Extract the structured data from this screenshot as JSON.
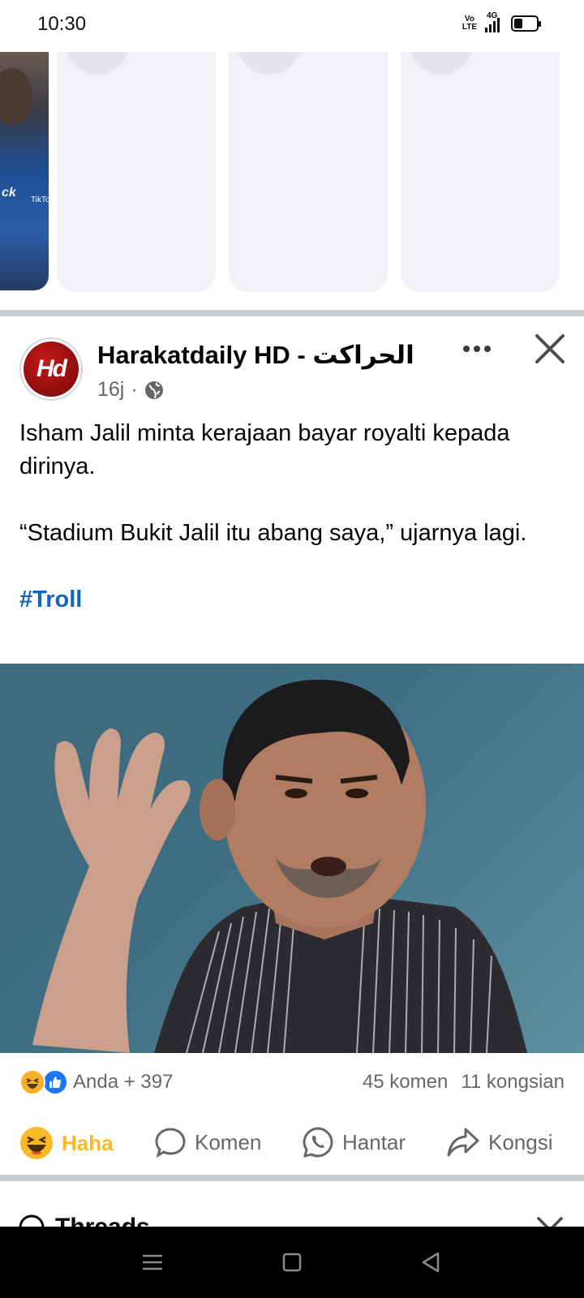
{
  "status_bar": {
    "time": "10:30",
    "volte_top": "Vo",
    "volte_bottom": "LTE",
    "network": "4G",
    "battery_level": 0.4
  },
  "stories": {
    "first_story_text": "ck",
    "first_story_brand": "TikTok"
  },
  "post": {
    "page_name": "Harakatdaily HD - الحراكت",
    "avatar_text": "Hd",
    "time_ago": "16j",
    "meta_separator": "·",
    "privacy_icon": "globe-icon",
    "text_line1": "Isham Jalil minta kerajaan bayar royalti kepada dirinya.",
    "text_line2": "“Stadium Bukit Jalil itu abang saya,” ujarnya lagi.",
    "hashtag": "#Troll",
    "reactions_label": "Anda + 397",
    "comments_label": "45 komen",
    "shares_label": "11 kongsian"
  },
  "actions": {
    "haha_label": "Haha",
    "comment_label": "Komen",
    "send_label": "Hantar",
    "share_label": "Kongsi"
  },
  "next_post": {
    "title": "Threads"
  },
  "colors": {
    "haha_active": "#f7b928",
    "hashtag": "#1065bd",
    "secondary_text": "#65676b",
    "like_blue": "#1877f2"
  }
}
